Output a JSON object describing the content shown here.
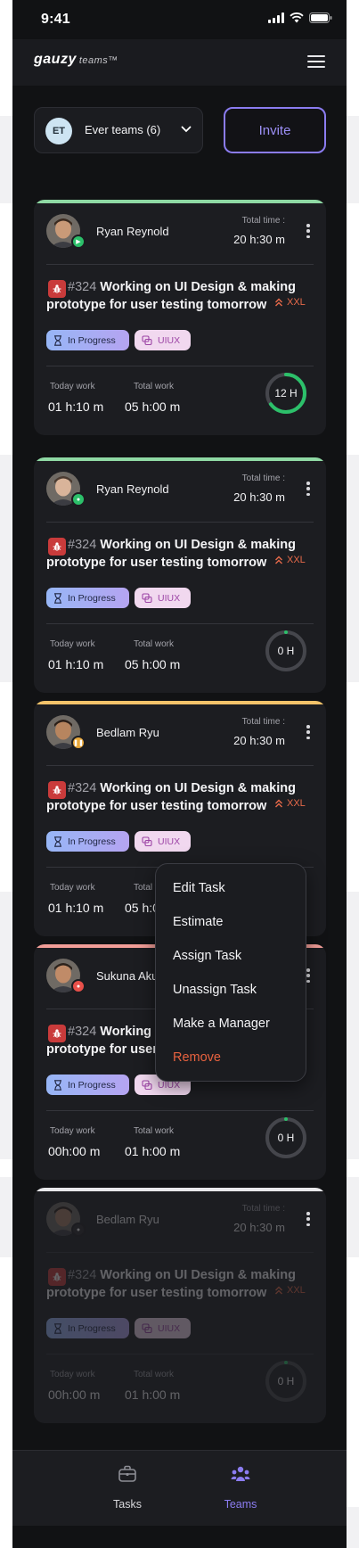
{
  "status_bar": {
    "time": "9:41"
  },
  "header": {
    "logo": "gauzy",
    "logo_sub": "teams™"
  },
  "team_select": {
    "avatar": "ET",
    "name": "Ever teams (6)"
  },
  "invite_label": "Invite",
  "colors": {
    "accent": "#8b7cf0",
    "green": "#2cc06a",
    "amber": "#f3c36a",
    "red": "#f19d97",
    "danger": "#e8623f"
  },
  "cards": [
    {
      "name": "Ryan Reynold",
      "total_time_label": "Total time :",
      "total_time": "20 h:30 m",
      "task_number": "#324",
      "task_title": "Working on UI Design & making prototype for user testing tomorrow",
      "size": "XXL",
      "status": "In Progress",
      "label": "UIUX",
      "today_work_label": "Today work",
      "today_work": "01 h:10 m",
      "total_work_label": "Total work",
      "total_work": "05 h:00 m",
      "ring": "12 H",
      "ring_progress": 0.65
    },
    {
      "name": "Ryan Reynold",
      "total_time_label": "Total time :",
      "total_time": "20 h:30 m",
      "task_number": "#324",
      "task_title": "Working on UI Design & making prototype for user testing tomorrow",
      "size": "XXL",
      "status": "In Progress",
      "label": "UIUX",
      "today_work_label": "Today work",
      "today_work": "01 h:10 m",
      "total_work_label": "Total work",
      "total_work": "05 h:00 m",
      "ring": "0 H",
      "ring_progress": 0
    },
    {
      "name": "Bedlam Ryu",
      "total_time_label": "Total time :",
      "total_time": "20 h:30 m",
      "task_number": "#324",
      "task_title": "Working on UI Design & making prototype for user testing tomorrow",
      "size": "XXL",
      "status": "In Progress",
      "label": "UIUX",
      "today_work_label": "Today work",
      "today_work": "01 h:10 m",
      "total_work_label": "Total work",
      "total_work": "05 h:00 m",
      "ring": "",
      "ring_progress": 0.65
    },
    {
      "name": "Sukuna Aku",
      "total_time_label": "",
      "total_time": "",
      "task_number": "#324",
      "task_title": "Working on UI Design & making prototype for user testing tomorrow",
      "size": "",
      "status": "In Progress",
      "label": "UIUX",
      "today_work_label": "Today work",
      "today_work": "00h:00 m",
      "total_work_label": "Total work",
      "total_work": "01 h:00 m",
      "ring": "0 H",
      "ring_progress": 0
    },
    {
      "name": "Bedlam Ryu",
      "total_time_label": "Total time :",
      "total_time": "20 h:30 m",
      "task_number": "#324",
      "task_title": "Working on UI Design & making prototype for user testing tomorrow",
      "size": "XXL",
      "status": "In Progress",
      "label": "UIUX",
      "today_work_label": "Today work",
      "today_work": "00h:00 m",
      "total_work_label": "Total work",
      "total_work": "01 h:00 m",
      "ring": "0 H",
      "ring_progress": 0
    }
  ],
  "menu": {
    "items": [
      "Edit Task",
      "Estimate",
      "Assign Task",
      "Unassign Task",
      "Make a Manager",
      "Remove"
    ]
  },
  "tabs": [
    {
      "label": "Tasks"
    },
    {
      "label": "Teams"
    }
  ]
}
